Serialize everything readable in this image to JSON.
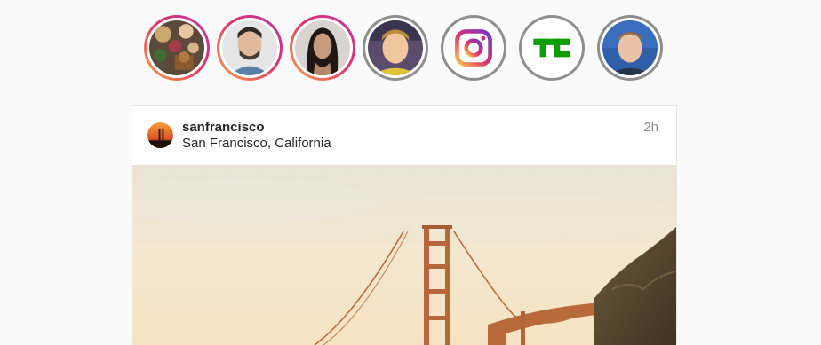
{
  "stories": [
    {
      "name": "story-flowers",
      "state": "unseen"
    },
    {
      "name": "story-alexis",
      "state": "unseen"
    },
    {
      "name": "story-kim",
      "state": "unseen"
    },
    {
      "name": "story-friend",
      "state": "seen"
    },
    {
      "name": "story-instagram",
      "state": "seen"
    },
    {
      "name": "story-techcrunch",
      "state": "seen"
    },
    {
      "name": "story-mark",
      "state": "seen"
    }
  ],
  "post": {
    "username": "sanfrancisco",
    "location": "San Francisco, California",
    "time": "2h"
  },
  "colors": {
    "story_gradient_start": "#f8a547",
    "story_gradient_end": "#b73aa6",
    "seen_ring": "#8e8e8e",
    "text": "#262626",
    "muted": "#8e8e8e",
    "techcrunch_green": "#0a9e01"
  }
}
